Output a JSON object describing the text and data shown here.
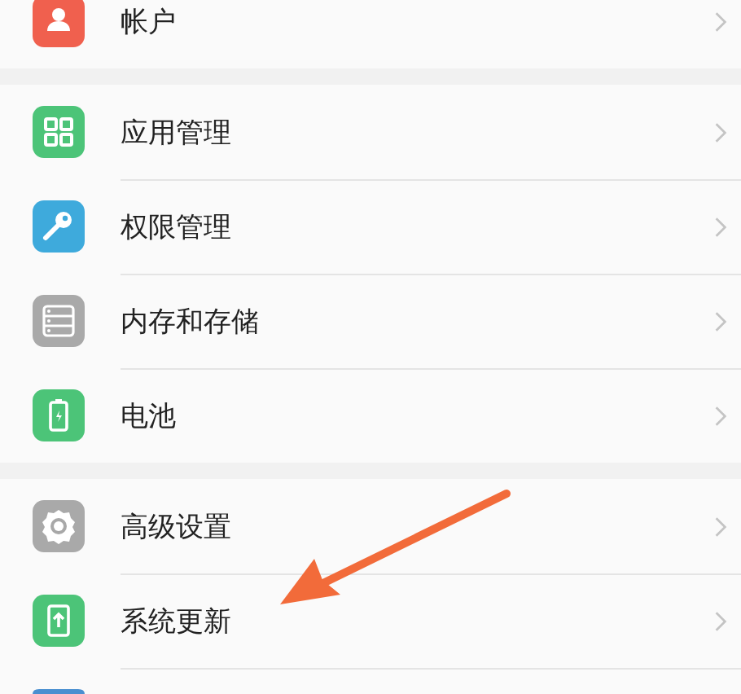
{
  "groups": [
    {
      "items": [
        {
          "label": "帐户",
          "kind": "account"
        }
      ]
    },
    {
      "items": [
        {
          "label": "应用管理",
          "kind": "apps"
        },
        {
          "label": "权限管理",
          "kind": "key"
        },
        {
          "label": "内存和存储",
          "kind": "storage"
        },
        {
          "label": "电池",
          "kind": "battery"
        }
      ]
    },
    {
      "items": [
        {
          "label": "高级设置",
          "kind": "gear"
        },
        {
          "label": "系统更新",
          "kind": "update"
        },
        {
          "kind": "partial"
        }
      ]
    }
  ]
}
